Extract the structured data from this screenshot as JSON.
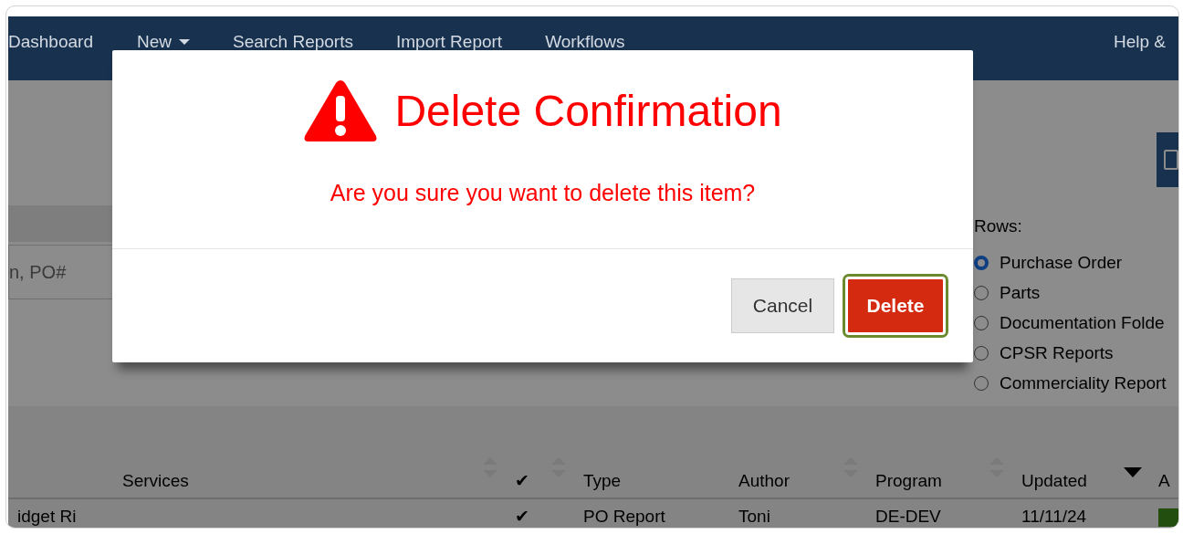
{
  "nav": {
    "items": [
      {
        "label": "Dashboard",
        "dropdown": false
      },
      {
        "label": "New",
        "dropdown": true
      },
      {
        "label": "Search Reports",
        "dropdown": false
      },
      {
        "label": "Import Report",
        "dropdown": false
      },
      {
        "label": "Workflows",
        "dropdown": false
      }
    ],
    "help": "Help &"
  },
  "search": {
    "placeholder": "n, PO#"
  },
  "rows_filter": {
    "title": "Rows:",
    "options": [
      {
        "label": "Purchase Order",
        "selected": true
      },
      {
        "label": "Parts",
        "selected": false
      },
      {
        "label": "Documentation Folde",
        "selected": false
      },
      {
        "label": "CPSR Reports",
        "selected": false
      },
      {
        "label": "Commerciality Report",
        "selected": false
      }
    ]
  },
  "table": {
    "columns": [
      {
        "sortable": false,
        "sorted_desc": false
      },
      {
        "label": "Services",
        "sortable": true,
        "sorted_desc": false
      },
      {
        "label": "✔",
        "sortable": true,
        "sorted_desc": false
      },
      {
        "label": "Type",
        "sortable": false,
        "sorted_desc": false
      },
      {
        "label": "Author",
        "sortable": true,
        "sorted_desc": false
      },
      {
        "label": "Program",
        "sortable": true,
        "sorted_desc": false
      },
      {
        "label": "Updated",
        "sortable": true,
        "sorted_desc": true
      },
      {
        "label": "A",
        "sortable": false,
        "sorted_desc": false
      }
    ],
    "rows": [
      {
        "cells": [
          "idget Ri",
          "",
          "✔",
          "PO Report",
          "Toni",
          "DE-DEV",
          "11/11/24",
          ""
        ]
      }
    ]
  },
  "dialog": {
    "title": "Delete Confirmation",
    "message": "Are you sure you want to delete this item?",
    "buttons": [
      {
        "label": "Cancel",
        "kind": "secondary"
      },
      {
        "label": "Delete",
        "kind": "danger"
      }
    ]
  }
}
